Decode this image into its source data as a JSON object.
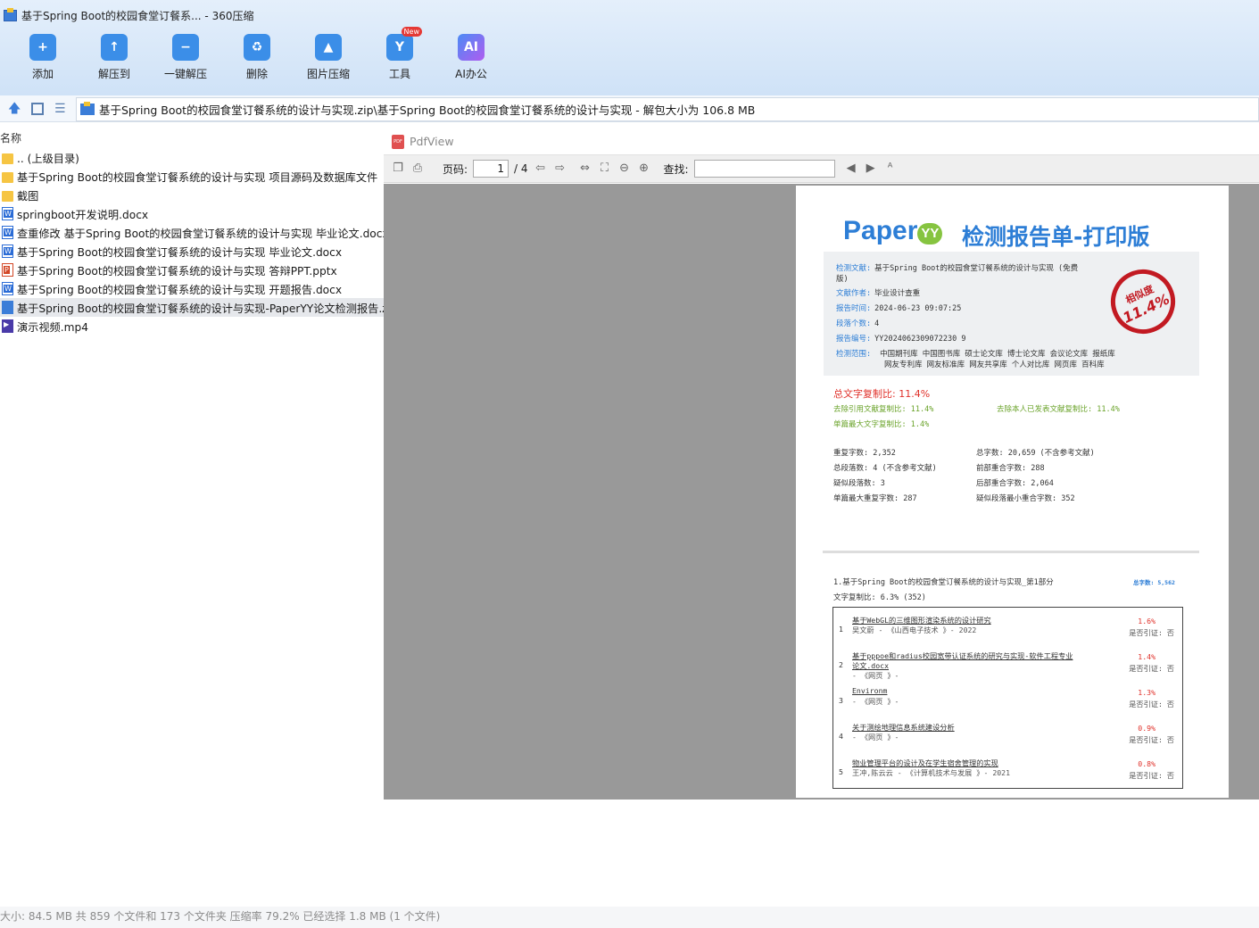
{
  "window": {
    "title": "基于Spring Boot的校园食堂订餐系... - 360压缩"
  },
  "toolbar": [
    {
      "label": "添加",
      "icon": "add-icon"
    },
    {
      "label": "解压到",
      "icon": "extract-to-icon"
    },
    {
      "label": "一键解压",
      "icon": "one-click-extract-icon"
    },
    {
      "label": "删除",
      "icon": "delete-icon"
    },
    {
      "label": "图片压缩",
      "icon": "image-compress-icon"
    },
    {
      "label": "工具",
      "icon": "tools-icon",
      "badge": "New"
    },
    {
      "label": "AI办公",
      "icon": "ai-office-icon",
      "glyph": "AI"
    }
  ],
  "address": {
    "path": "基于Spring Boot的校园食堂订餐系统的设计与实现.zip\\基于Spring Boot的校园食堂订餐系统的设计与实现 - 解包大小为 106.8 MB"
  },
  "filelist": {
    "header": "名称",
    "items": [
      {
        "name": ".. (上级目录)",
        "type": "folder"
      },
      {
        "name": "基于Spring Boot的校园食堂订餐系统的设计与实现 项目源码及数据库文件",
        "type": "folder"
      },
      {
        "name": "截图",
        "type": "folder"
      },
      {
        "name": "springboot开发说明.docx",
        "type": "doc"
      },
      {
        "name": "查重修改 基于Spring Boot的校园食堂订餐系统的设计与实现 毕业论文.docx",
        "type": "doc"
      },
      {
        "name": "基于Spring Boot的校园食堂订餐系统的设计与实现 毕业论文.docx",
        "type": "doc"
      },
      {
        "name": "基于Spring Boot的校园食堂订餐系统的设计与实现 答辩PPT.pptx",
        "type": "ppt"
      },
      {
        "name": "基于Spring Boot的校园食堂订餐系统的设计与实现 开题报告.docx",
        "type": "doc"
      },
      {
        "name": "基于Spring Boot的校园食堂订餐系统的设计与实现-PaperYY论文检测报告.zi",
        "type": "zipf",
        "selected": true
      },
      {
        "name": "演示视频.mp4",
        "type": "mp4"
      }
    ]
  },
  "pdfview": {
    "title": "PdfView",
    "page_label": "页码:",
    "page_current": "1",
    "page_total": "/ 4",
    "find_label": "查找:",
    "find_value": ""
  },
  "report": {
    "logo": "Paper",
    "logo_mark": "YY",
    "heading": "检测报告单-打印版",
    "fields": [
      {
        "k": "检测文献:",
        "v": "基于Spring Boot的校园食堂订餐系统的设计与实现 (免费"
      },
      {
        "k": "",
        "v": "版)"
      },
      {
        "k": "文献作者:",
        "v": "毕业设计查重"
      },
      {
        "k": "报告时间:",
        "v": "2024-06-23 09:07:25"
      },
      {
        "k": "段落个数:",
        "v": "4"
      },
      {
        "k": "报告编号:",
        "v": "YY2024062309072230 9"
      },
      {
        "k": "检测范围:",
        "v": "中国期刊库 中国图书库 硕士论文库 博士论文库 会议论文库 报纸库"
      },
      {
        "k": "",
        "v": "网友专利库 网友标准库 网友共享库 个人对比库 网页库 百科库"
      }
    ],
    "stamp_top": "相似度",
    "stamp_value": "11.4%",
    "total_ratio": "总文字复制比: 11.4%",
    "excl_cite": "去除引用文献复制比: 11.4%",
    "excl_self": "去除本人已发表文献复制比: 11.4%",
    "single_max": "单篇最大文字复制比: 1.4%",
    "stats": [
      "重复字数: 2,352",
      "总字数: 20,659 (不含参考文献)",
      "总段落数: 4 (不含参考文献)",
      "前部重合字数: 288",
      "疑似段落数: 3",
      "后部重合字数: 2,064",
      "单篇最大重复字数: 287",
      "疑似段落最小重合字数: 352"
    ],
    "section_title": "1.基于Spring Boot的校园食堂订餐系统的设计与实现_第1部分",
    "section_count": "总字数: 5,562",
    "section_ratio": "文字复制比: 6.3% (352)",
    "refs": [
      {
        "n": "1",
        "a": "基于WebGL的三维图形渲染系统的设计研究",
        "b": "吴文蔚 - 《山西电子技术 》- 2022",
        "p": "1.6%",
        "q": "是否引证: 否"
      },
      {
        "n": "2",
        "a": "基于pppoe和radius校园宽带认证系统的研究与实现-软件工程专业",
        "a2": "论文.docx",
        "b": "- 《网页 》-",
        "p": "1.4%",
        "q": "是否引证: 否"
      },
      {
        "n": "3",
        "a": "Environm",
        "b": "- 《网页 》-",
        "p": "1.3%",
        "q": "是否引证: 否"
      },
      {
        "n": "4",
        "a": "关于测绘地理信息系统建设分析",
        "b": "- 《网页 》-",
        "p": "0.9%",
        "q": "是否引证: 否"
      },
      {
        "n": "5",
        "a": "物业管理平台的设计及在学生宿舍管理的实现",
        "b": "王冲,陈云云 - 《计算机技术与发展 》- 2021",
        "p": "0.8%",
        "q": "是否引证: 否"
      }
    ]
  },
  "status": {
    "text": "大小: 84.5 MB 共 859 个文件和 173 个文件夹 压缩率 79.2% 已经选择 1.8 MB (1 个文件)"
  }
}
